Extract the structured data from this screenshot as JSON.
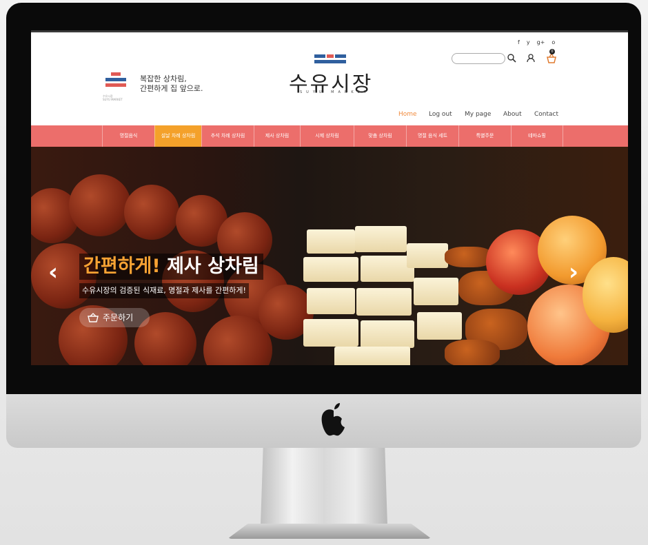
{
  "header": {
    "slogan": "복잡한 상차림,\n간편하게 집 앞으로.",
    "slogan_logo_text": "수유시장\nSUYU MARKET",
    "logo": "수유시장",
    "logo_sub": "SUYU MARKET",
    "cart_count": "0",
    "search_placeholder": "",
    "social": [
      "f",
      "y",
      "g+",
      "o"
    ]
  },
  "top_nav": [
    "Home",
    "Log out",
    "My page",
    "About",
    "Contact"
  ],
  "categories": [
    "명절음식",
    "설날 차례 상차림",
    "추석 차례 상차림",
    "제사 상차림",
    "시제 상차림",
    "맞춤 상차림",
    "명절 음식 세트",
    "특별주문",
    "테마쇼핑"
  ],
  "hero": {
    "headline_accent": "간편하게!",
    "headline_rest": " 제사 상차림",
    "subline": "수유시장의 검증된 식재료, 명절과 제사를 간편하게!",
    "order_label": "주문하기"
  },
  "colors": {
    "catbar": "#ec6e6b",
    "active_cat": "#f4a12a",
    "home_link": "#f08a3c"
  }
}
